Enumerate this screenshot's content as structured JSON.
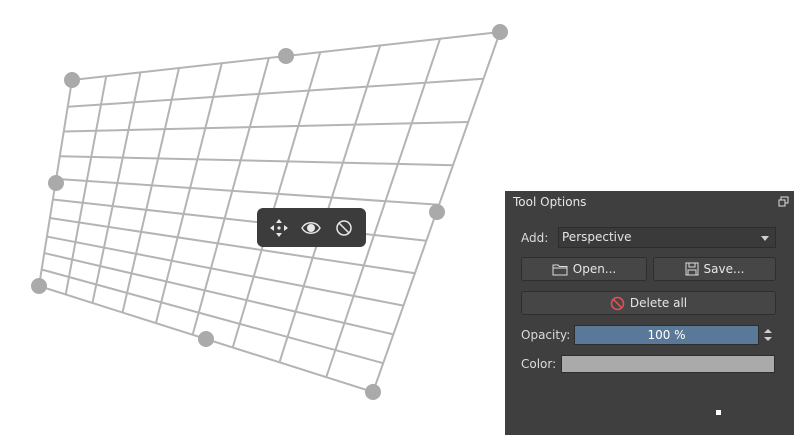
{
  "canvas": {
    "grid_color": "#b4b4b4",
    "handle_color": "#aaaaaa"
  },
  "assistant_toolbar": {
    "icons": [
      "move-icon",
      "eye-icon",
      "disable-icon"
    ]
  },
  "tool_options": {
    "title": "Tool Options",
    "add_label": "Add:",
    "add_value": "Perspective",
    "open_label": "Open...",
    "save_label": "Save...",
    "delete_all_label": "Delete all",
    "opacity_label": "Opacity:",
    "opacity_value": "100 %",
    "color_label": "Color:",
    "color_value": "#aaaaaa",
    "accent": "#5a7898"
  }
}
